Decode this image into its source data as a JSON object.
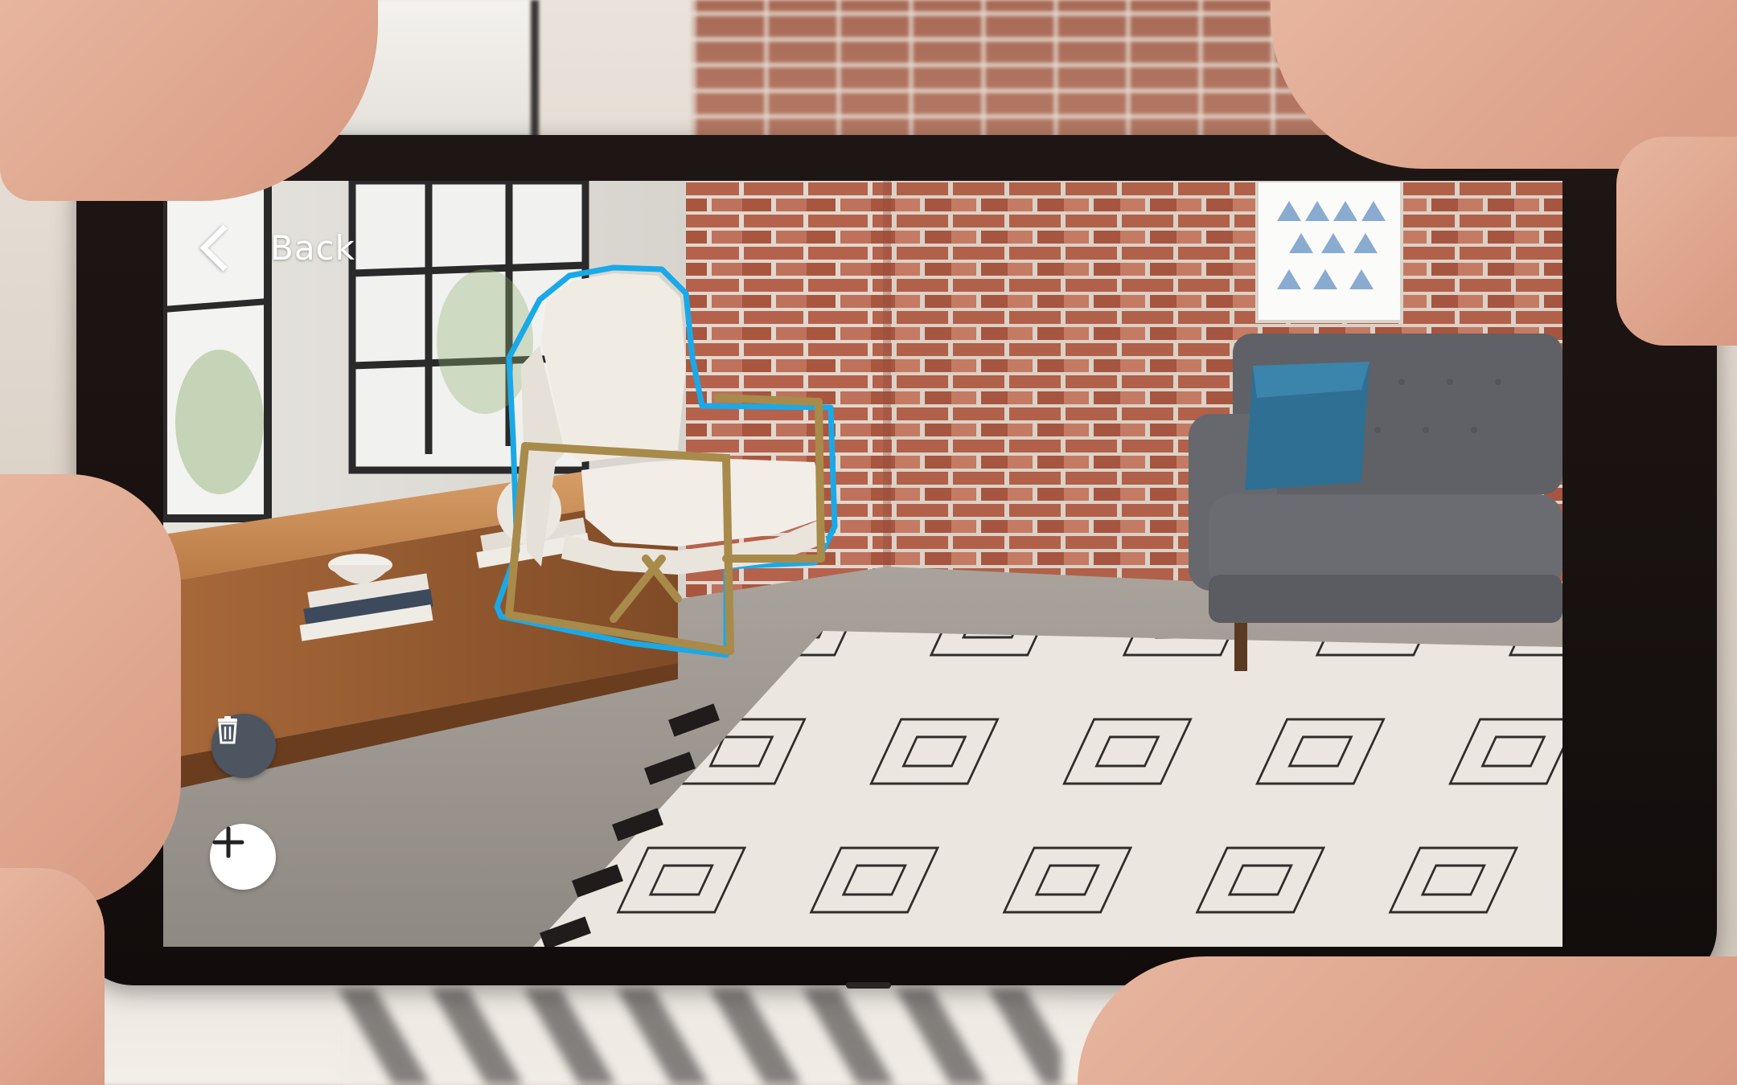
{
  "toolbar": {
    "back_label": "Back",
    "back_icon": "chevron-left-icon"
  },
  "actions": {
    "delete_icon": "trash-icon",
    "add_icon": "plus-icon"
  },
  "placed_item": {
    "selection_outline_color": "#1aa9e8"
  },
  "colors": {
    "delete_button_bg": "#4c5560",
    "add_button_bg": "#ffffff"
  }
}
